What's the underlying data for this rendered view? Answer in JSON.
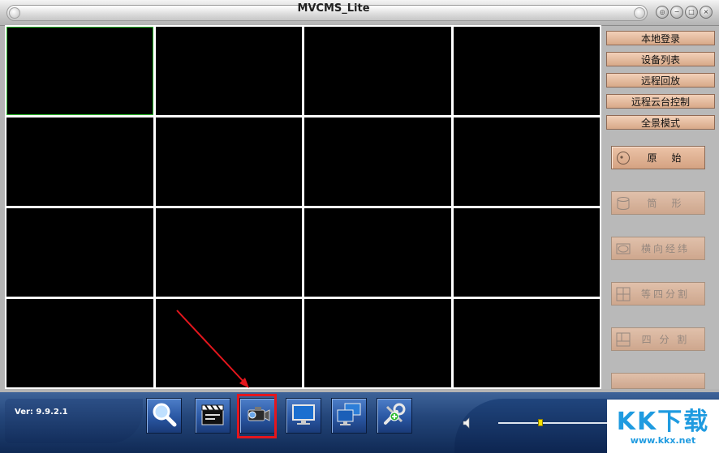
{
  "window": {
    "title": "MVCMS_Lite",
    "controls": [
      "◎",
      "−",
      "□",
      "×"
    ]
  },
  "grid": {
    "rows": 4,
    "cols": 4,
    "active_cell": 0
  },
  "menu": [
    {
      "label": "本地登录"
    },
    {
      "label": "设备列表"
    },
    {
      "label": "远程回放"
    },
    {
      "label": "远程云台控制"
    },
    {
      "label": "全景模式"
    }
  ],
  "modes": [
    {
      "label": "原　始",
      "icon": "disc-icon",
      "enabled": true
    },
    {
      "label": "筒　形",
      "icon": "cylinder-icon",
      "enabled": false
    },
    {
      "label": "横向经纬",
      "icon": "ellipse-icon",
      "enabled": false
    },
    {
      "label": "等四分割",
      "icon": "quad-split-icon",
      "enabled": false
    },
    {
      "label": "四 分 割",
      "icon": "split-icon",
      "enabled": false
    }
  ],
  "footer": {
    "version": "Ver: 9.9.2.1",
    "tools": [
      {
        "name": "search-tool",
        "icon": "magnifier-icon"
      },
      {
        "name": "record-tool",
        "icon": "clapperboard-icon"
      },
      {
        "name": "camera-tool",
        "icon": "camera-icon",
        "highlighted": true
      },
      {
        "name": "monitor-tool",
        "icon": "monitor-icon"
      },
      {
        "name": "multi-monitor-tool",
        "icon": "multi-monitor-icon"
      },
      {
        "name": "settings-tool",
        "icon": "wrench-plus-icon"
      }
    ],
    "volume": 0.38
  },
  "watermark": {
    "main": "KK下载",
    "url": "www.kkx.net"
  },
  "colors": {
    "accent_border": "#e4161d",
    "active_cell": "#2bb82b",
    "menu_button": "#e3b797",
    "toolbar_blue": "#24467a"
  }
}
